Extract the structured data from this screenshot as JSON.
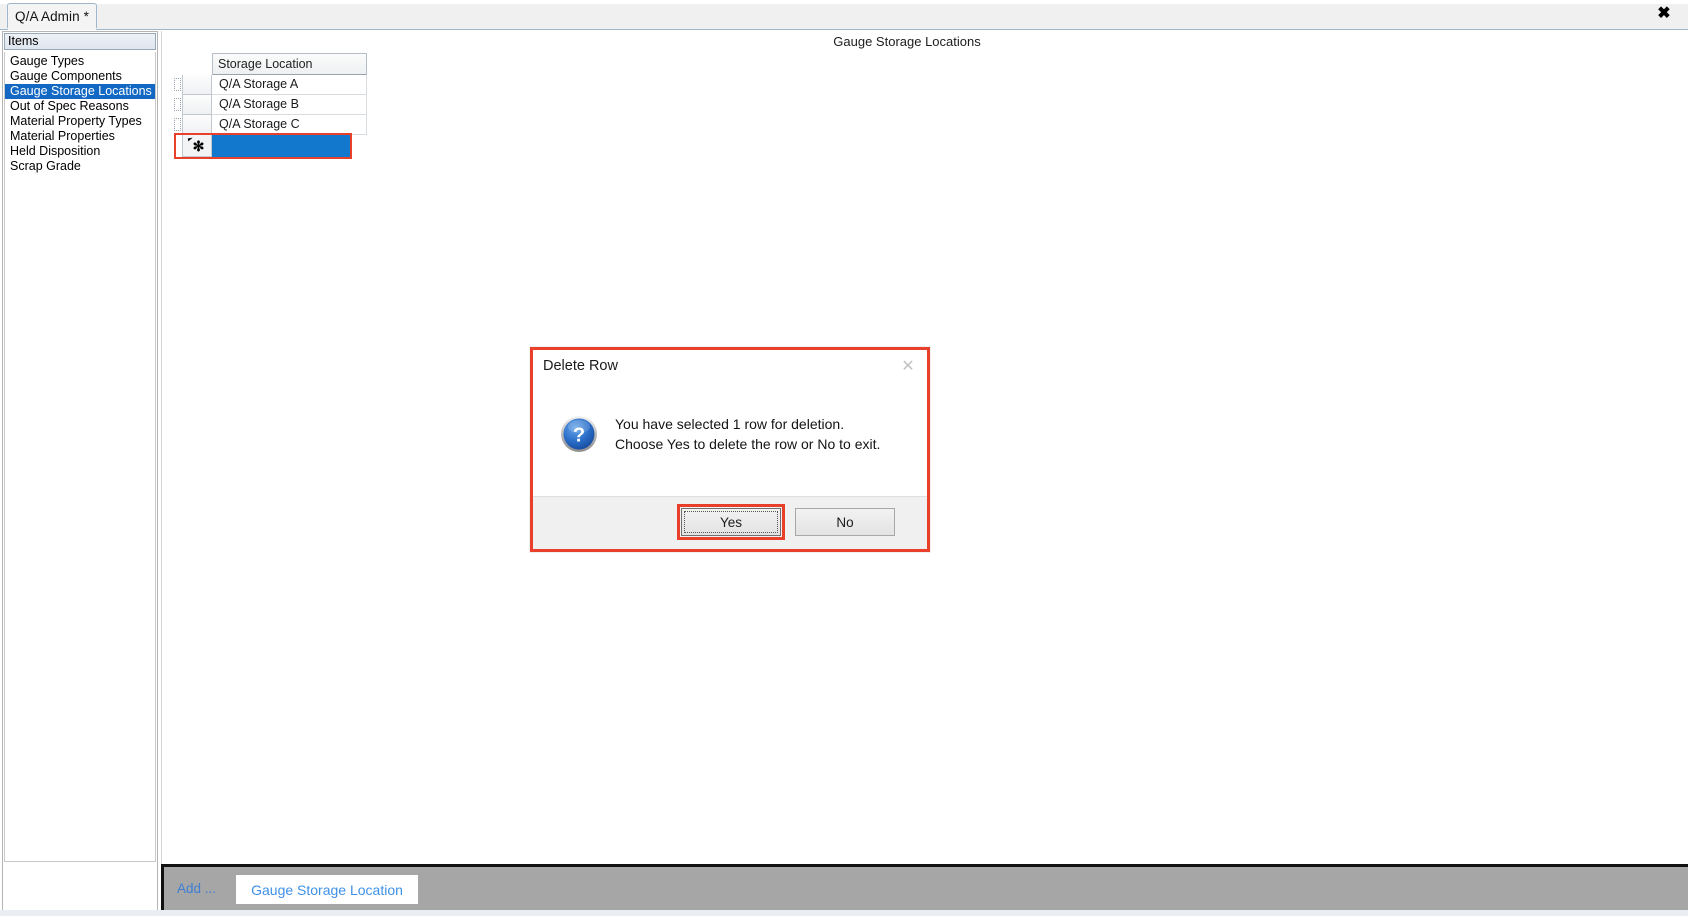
{
  "window": {
    "tab_label": "Q/A Admin *",
    "close_icon": "close-icon",
    "close_glyph": "✖"
  },
  "sidebar": {
    "header": "Items",
    "items": [
      {
        "label": "Gauge Types",
        "selected": false
      },
      {
        "label": "Gauge Components",
        "selected": false
      },
      {
        "label": "Gauge Storage Locations",
        "selected": true
      },
      {
        "label": "Out of Spec Reasons",
        "selected": false
      },
      {
        "label": "Material Property Types",
        "selected": false
      },
      {
        "label": "Material Properties",
        "selected": false
      },
      {
        "label": "Held Disposition",
        "selected": false
      },
      {
        "label": "Scrap Grade",
        "selected": false
      }
    ]
  },
  "main": {
    "title": "Gauge Storage Locations",
    "grid": {
      "columns": [
        "Storage Location"
      ],
      "rows": [
        {
          "storage_location": "Q/A Storage A"
        },
        {
          "storage_location": "Q/A Storage B"
        },
        {
          "storage_location": "Q/A Storage C"
        }
      ],
      "new_row": {
        "marker_glyph": "✻",
        "selected": true,
        "value": ""
      }
    }
  },
  "bottom_toolbar": {
    "add_label": "Add ...",
    "add_button_label": "Gauge Storage Location"
  },
  "dialog": {
    "title": "Delete Row",
    "close_glyph": "✕",
    "icon": "question-mark-icon",
    "message_line1": "You have selected 1 row for deletion.",
    "message_line2": "Choose Yes to delete the row or No to exit.",
    "buttons": {
      "yes": "Yes",
      "no": "No"
    }
  },
  "colors": {
    "selection_blue": "#1268c3",
    "grid_new_row_blue": "#1278ce",
    "highlight_red": "#e8402a",
    "toolbar_gray": "#a6a6a6",
    "link_blue": "#3e91e8"
  }
}
